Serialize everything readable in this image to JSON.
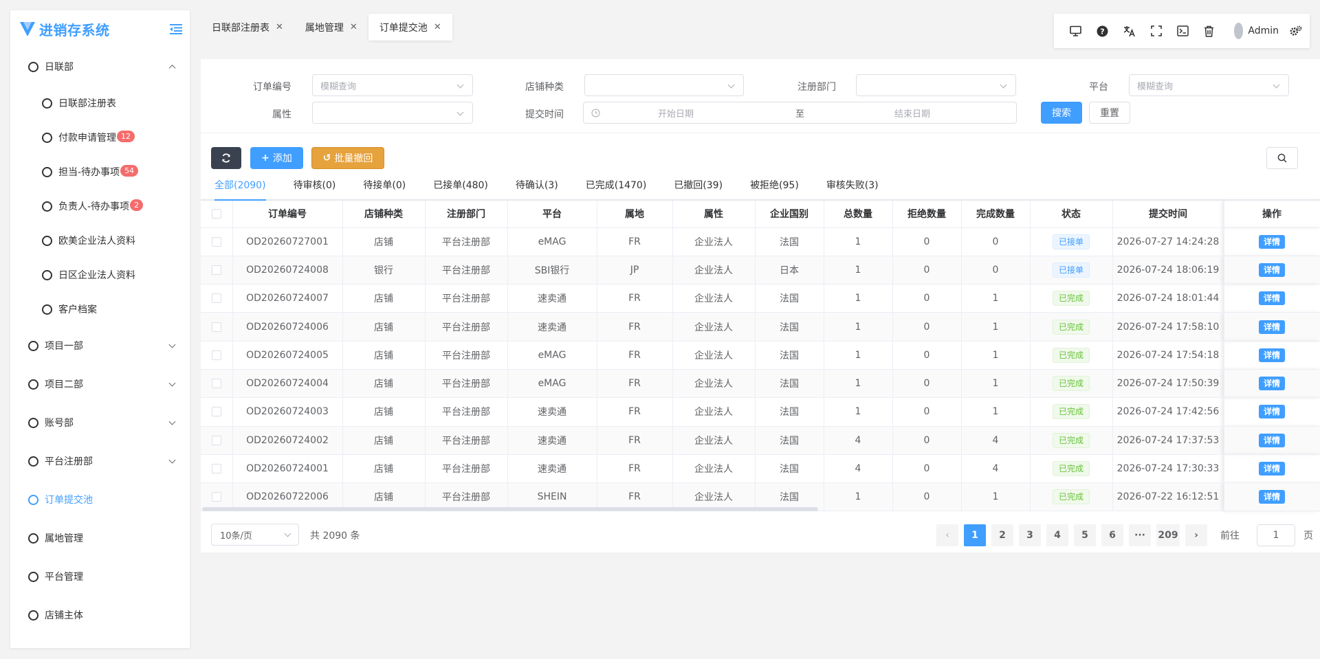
{
  "app": {
    "title": "进销存系统"
  },
  "sidebar": {
    "groups": [
      {
        "label": "日联部",
        "expanded": true,
        "children": [
          {
            "label": "日联部注册表",
            "badge": ""
          },
          {
            "label": "付款申请管理",
            "badge": "12"
          },
          {
            "label": "担当-待办事项",
            "badge": "54"
          },
          {
            "label": "负责人-待办事项",
            "badge": "2"
          },
          {
            "label": "欧美企业法人资料",
            "badge": ""
          },
          {
            "label": "日区企业法人资料",
            "badge": ""
          },
          {
            "label": "客户档案",
            "badge": ""
          }
        ]
      },
      {
        "label": "项目一部"
      },
      {
        "label": "项目二部"
      },
      {
        "label": "账号部"
      },
      {
        "label": "平台注册部"
      },
      {
        "label": "订单提交池"
      },
      {
        "label": "属地管理"
      },
      {
        "label": "平台管理"
      },
      {
        "label": "店铺主体"
      }
    ]
  },
  "tabs": [
    {
      "label": "日联部注册表"
    },
    {
      "label": "属地管理"
    },
    {
      "label": "订单提交池"
    }
  ],
  "toolbar": {
    "icons": [
      "monitor-icon",
      "help-icon",
      "translate-icon",
      "fullscreen-icon",
      "terminal-icon",
      "trash-icon"
    ],
    "user": "Admin"
  },
  "filters": {
    "order_no": {
      "label": "订单编号",
      "placeholder": "模糊查询"
    },
    "shop_type": {
      "label": "店铺种类",
      "placeholder": ""
    },
    "reg_dept": {
      "label": "注册部门",
      "placeholder": ""
    },
    "platform": {
      "label": "平台",
      "placeholder": "模糊查询"
    },
    "attribute": {
      "label": "属性",
      "placeholder": ""
    },
    "submit_time": {
      "label": "提交时间",
      "start": "开始日期",
      "sep": "至",
      "end": "结束日期"
    },
    "search": "搜索",
    "reset": "重置"
  },
  "actions": {
    "add": "添加",
    "batch_revoke": "批量撤回"
  },
  "status_tabs": [
    "全部(2090)",
    "待审核(0)",
    "待接单(0)",
    "已接单(480)",
    "待确认(3)",
    "已完成(1470)",
    "已撤回(39)",
    "被拒绝(95)",
    "审核失败(3)"
  ],
  "table": {
    "columns": [
      "订单编号",
      "店铺种类",
      "注册部门",
      "平台",
      "属地",
      "属性",
      "企业国别",
      "总数量",
      "拒绝数量",
      "完成数量",
      "状态",
      "提交时间",
      "操作"
    ],
    "detail_label": "详情",
    "rows": [
      [
        "OD20260727001",
        "店铺",
        "平台注册部",
        "eMAG",
        "FR",
        "企业法人",
        "法国",
        "1",
        "0",
        "0",
        "已接单",
        "2026-07-27 14:24:28"
      ],
      [
        "OD20260724008",
        "银行",
        "平台注册部",
        "SBI银行",
        "JP",
        "企业法人",
        "日本",
        "1",
        "0",
        "0",
        "已接单",
        "2026-07-24 18:06:19"
      ],
      [
        "OD20260724007",
        "店铺",
        "平台注册部",
        "速卖通",
        "FR",
        "企业法人",
        "法国",
        "1",
        "0",
        "1",
        "已完成",
        "2026-07-24 18:01:44"
      ],
      [
        "OD20260724006",
        "店铺",
        "平台注册部",
        "速卖通",
        "FR",
        "企业法人",
        "法国",
        "1",
        "0",
        "1",
        "已完成",
        "2026-07-24 17:58:10"
      ],
      [
        "OD20260724005",
        "店铺",
        "平台注册部",
        "eMAG",
        "FR",
        "企业法人",
        "法国",
        "1",
        "0",
        "1",
        "已完成",
        "2026-07-24 17:54:18"
      ],
      [
        "OD20260724004",
        "店铺",
        "平台注册部",
        "eMAG",
        "FR",
        "企业法人",
        "法国",
        "1",
        "0",
        "1",
        "已完成",
        "2026-07-24 17:50:39"
      ],
      [
        "OD20260724003",
        "店铺",
        "平台注册部",
        "速卖通",
        "FR",
        "企业法人",
        "法国",
        "1",
        "0",
        "1",
        "已完成",
        "2026-07-24 17:42:56"
      ],
      [
        "OD20260724002",
        "店铺",
        "平台注册部",
        "速卖通",
        "FR",
        "企业法人",
        "法国",
        "4",
        "0",
        "4",
        "已完成",
        "2026-07-24 17:37:53"
      ],
      [
        "OD20260724001",
        "店铺",
        "平台注册部",
        "速卖通",
        "FR",
        "企业法人",
        "法国",
        "4",
        "0",
        "4",
        "已完成",
        "2026-07-24 17:30:33"
      ],
      [
        "OD20260722006",
        "店铺",
        "平台注册部",
        "SHEIN",
        "FR",
        "企业法人",
        "法国",
        "1",
        "0",
        "1",
        "已完成",
        "2026-07-22 16:12:51"
      ]
    ]
  },
  "pagination": {
    "page_size": "10条/页",
    "total": "共 2090 条",
    "pages": [
      "1",
      "2",
      "3",
      "4",
      "5",
      "6",
      "···",
      "209"
    ],
    "goto_prefix": "前往",
    "goto_value": "1",
    "goto_suffix": "页"
  },
  "colors": {
    "primary": "#409eff",
    "warning": "#e6a23c",
    "danger": "#f56c6c",
    "success": "#67c23a"
  }
}
